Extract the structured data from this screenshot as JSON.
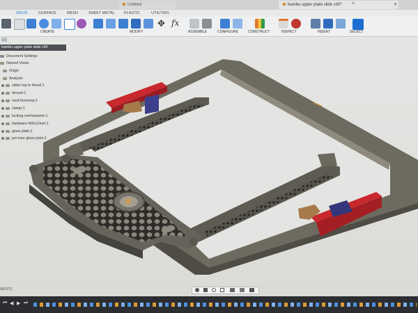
{
  "window": {
    "untitled_tab": "Untitled",
    "active_tab": "bambu upper plate slide v30*"
  },
  "workspace_tabs": [
    "SOLID",
    "SURFACE",
    "MESH",
    "SHEET METAL",
    "PLASTIC",
    "UTILITIES"
  ],
  "toolbar": {
    "create": "CREATE",
    "modify": "MODIFY",
    "assemble": "ASSEMBLE",
    "configure": "CONFIGURE",
    "construct": "CONSTRUCT",
    "inspect": "INSPECT",
    "insert": "INSERT",
    "select": "SELECT"
  },
  "browser": {
    "root": "bambu upper plate slide v30",
    "items": [
      "Document Settings",
      "Named Views",
      "Origin",
      "Analysis",
      "slider top to friend:1",
      "deuvet:1",
      "rand bovenop:1",
      "clamp:1",
      "locking merhanisme:1",
      "hardware M3x12mm:1",
      "glass plate:1",
      "pei riser glass plate:1"
    ]
  },
  "bottom": {
    "comments_label": "MENTS"
  },
  "colors": {
    "accent": "#1a6fd1",
    "frame": "#6d6a5f",
    "clamp_red": "#c8282e",
    "clamp_blue": "#3b3f8c",
    "slider_tan": "#a77a4c"
  }
}
